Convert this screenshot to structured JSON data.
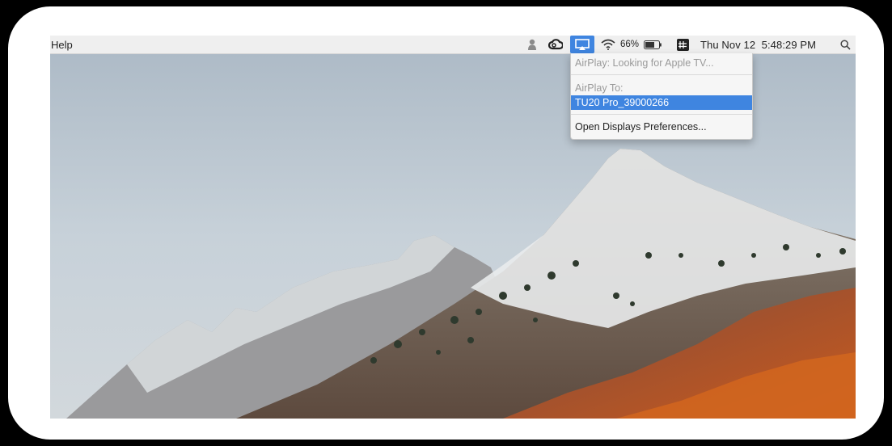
{
  "menubar": {
    "app_menu": "Help",
    "battery_percent": "66%",
    "datetime": "Thu Nov 12  5:48:29 PM",
    "icons": [
      "user-silhouette-icon",
      "creative-cloud-icon",
      "airplay-icon",
      "wifi-icon",
      "battery-icon",
      "input-source-icon",
      "spotlight-search-icon"
    ]
  },
  "airplay_menu": {
    "status": "AirPlay: Looking for Apple TV...",
    "airplay_to_label": "AirPlay To:",
    "selected_device": "TU20 Pro_39000266",
    "open_prefs": "Open Displays Preferences..."
  },
  "colors": {
    "accent": "#3f85e0",
    "menubar_bg": "#efefef",
    "outer_bg": "#000000",
    "frame_bg": "#ffffff"
  },
  "wallpaper": "high-sierra-mountain"
}
